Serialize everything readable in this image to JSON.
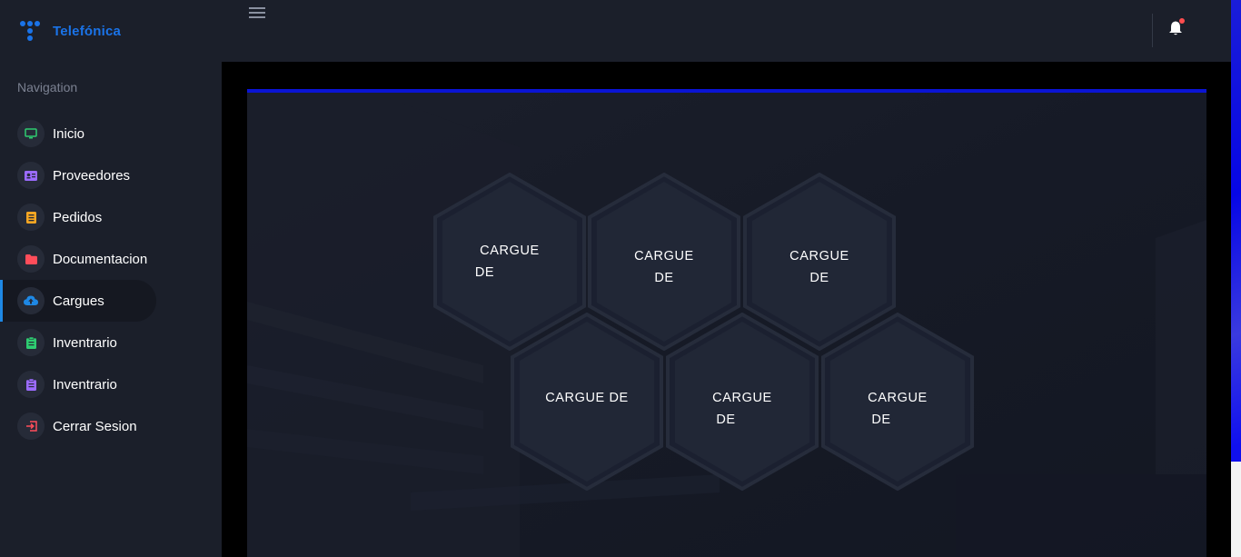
{
  "brand": {
    "name": "Telefónica",
    "color": "#1a73e8"
  },
  "nav": {
    "heading": "Navigation",
    "items": [
      {
        "label": "Inicio",
        "icon": "monitor-icon",
        "color": "#2ecc71"
      },
      {
        "label": "Proveedores",
        "icon": "id-card-icon",
        "color": "#9b6bff"
      },
      {
        "label": "Pedidos",
        "icon": "notebook-icon",
        "color": "#f5a623"
      },
      {
        "label": "Documentacion",
        "icon": "folder-icon",
        "color": "#ff4d5a"
      },
      {
        "label": "Cargues",
        "icon": "cloud-upload-icon",
        "color": "#1e88e5",
        "active": true
      },
      {
        "label": "Inventrario",
        "icon": "clipboard-icon",
        "color": "#2ecc71"
      },
      {
        "label": "Inventrario",
        "icon": "clipboard-icon",
        "color": "#9b6bff"
      },
      {
        "label": "Cerrar Sesion",
        "icon": "logout-icon",
        "color": "#ff4d5a"
      }
    ]
  },
  "topbar": {
    "menu_icon": "hamburger-icon",
    "notification_icon": "bell-icon"
  },
  "main": {
    "accent": "#0a14d4",
    "tiles": [
      {
        "line1": "CARGUE",
        "line2": "DE"
      },
      {
        "line1": "CARGUE",
        "line2": "DE"
      },
      {
        "line1": "CARGUE",
        "line2": "DE"
      },
      {
        "line1": "CARGUE DE",
        "line2": ""
      },
      {
        "line1": "CARGUE",
        "line2": "DE"
      },
      {
        "line1": "CARGUE",
        "line2": "DE"
      }
    ]
  }
}
